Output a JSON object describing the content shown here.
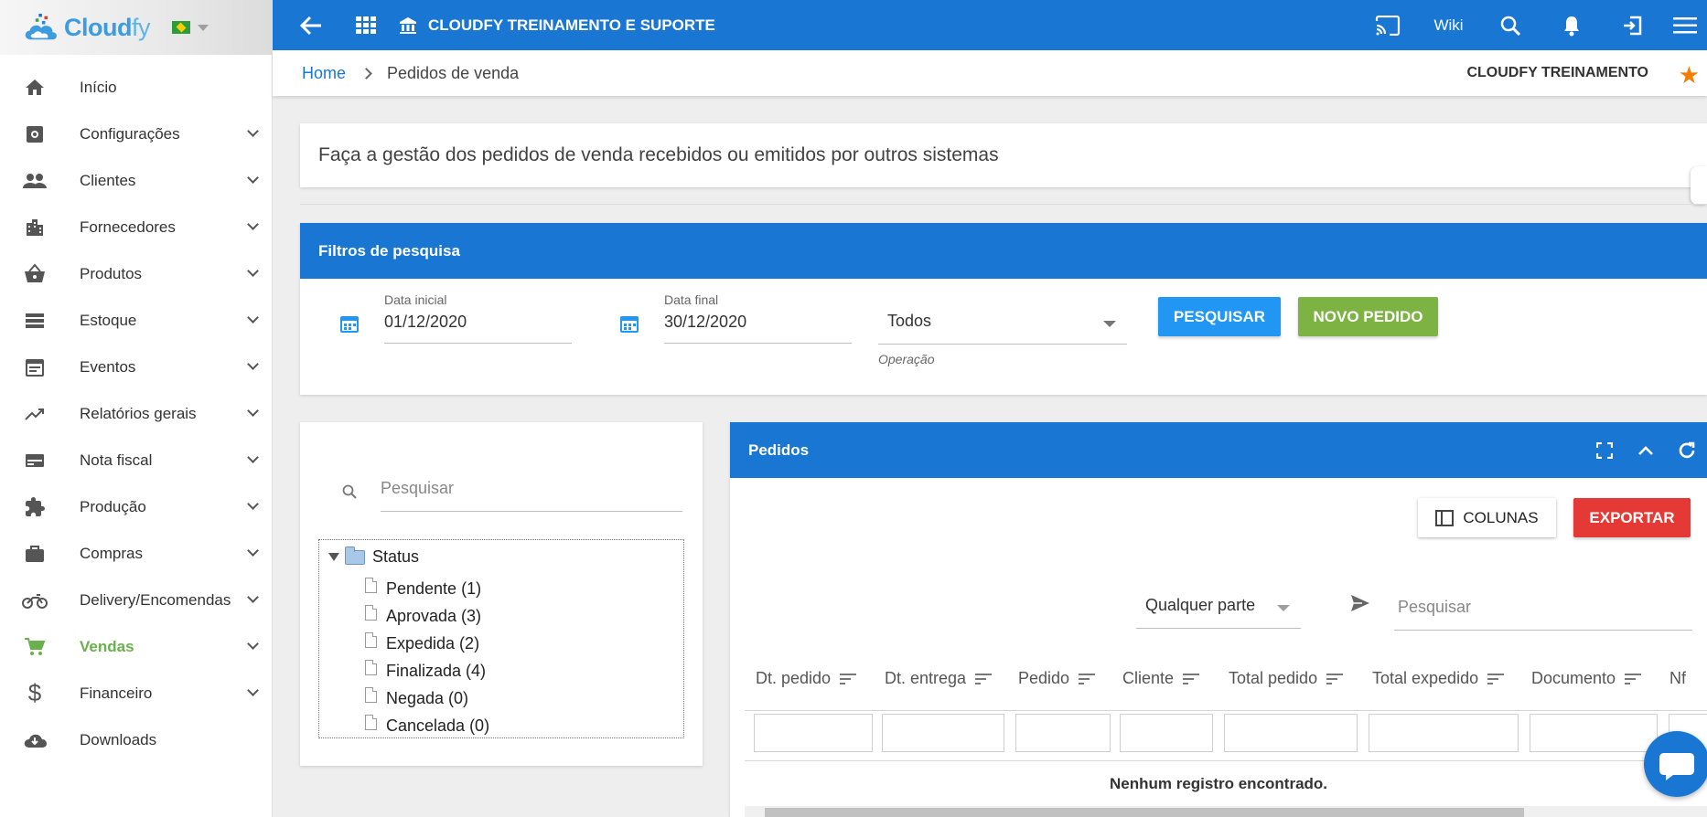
{
  "brand": {
    "name_part1": "Cloud",
    "name_part2": "fy"
  },
  "sidebar": {
    "items": [
      {
        "label": "Início",
        "icon": "home-icon"
      },
      {
        "label": "Configurações",
        "icon": "settings-icon"
      },
      {
        "label": "Clientes",
        "icon": "people-icon"
      },
      {
        "label": "Fornecedores",
        "icon": "building-icon"
      },
      {
        "label": "Produtos",
        "icon": "basket-icon"
      },
      {
        "label": "Estoque",
        "icon": "list-icon"
      },
      {
        "label": "Eventos",
        "icon": "event-icon"
      },
      {
        "label": "Relatórios gerais",
        "icon": "trending-icon"
      },
      {
        "label": "Nota fiscal",
        "icon": "card-icon"
      },
      {
        "label": "Produção",
        "icon": "puzzle-icon"
      },
      {
        "label": "Compras",
        "icon": "briefcase-icon"
      },
      {
        "label": "Delivery/Encomendas",
        "icon": "motorcycle-icon"
      },
      {
        "label": "Vendas",
        "icon": "cart-icon"
      },
      {
        "label": "Financeiro",
        "icon": "dollar-icon"
      },
      {
        "label": "Downloads",
        "icon": "cloud-download-icon"
      }
    ],
    "active_color": "#6ab04c"
  },
  "topbar": {
    "title": "CLOUDFY TREINAMENTO E SUPORTE",
    "wiki": "Wiki",
    "color": "#1976d2"
  },
  "breadcrumb": {
    "home": "Home",
    "current": "Pedidos de venda",
    "company": "CLOUDFY TREINAMENTO"
  },
  "description": "Faça a gestão dos pedidos de venda recebidos ou emitidos por outros sistemas",
  "filters": {
    "title": "Filtros de pesquisa",
    "start_label": "Data inicial",
    "start_value": "01/12/2020",
    "end_label": "Data final",
    "end_value": "30/12/2020",
    "operation_value": "Todos",
    "operation_hint": "Operação",
    "search_button": "PESQUISAR",
    "new_button": "NOVO PEDIDO"
  },
  "tree": {
    "search_placeholder": "Pesquisar",
    "root": "Status",
    "children": [
      "Pendente (1)",
      "Aprovada (3)",
      "Expedida (2)",
      "Finalizada (4)",
      "Negada (0)",
      "Cancelada (0)"
    ]
  },
  "orders": {
    "title": "Pedidos",
    "columns_button": "COLUNAS",
    "export_button": "EXPORTAR",
    "match_select": "Qualquer parte",
    "search_placeholder": "Pesquisar",
    "columns": [
      "Dt. pedido",
      "Dt. entrega",
      "Pedido",
      "Cliente",
      "Total pedido",
      "Total expedido",
      "Documento",
      "Nf"
    ],
    "empty": "Nenhum registro encontrado."
  }
}
